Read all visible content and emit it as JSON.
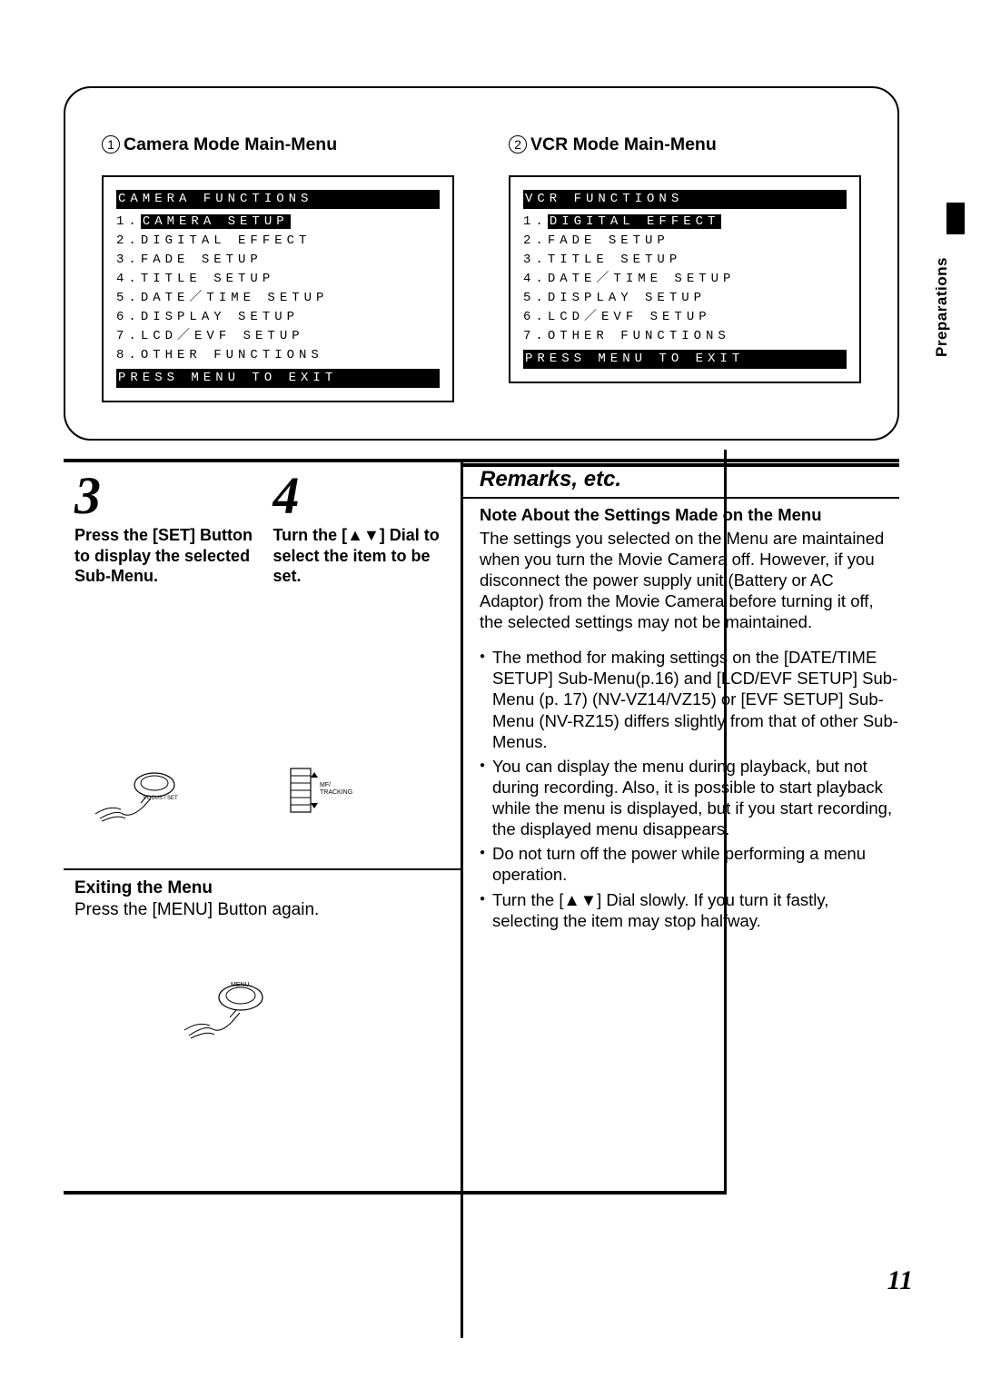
{
  "sidebar_label": "Preparations",
  "camera_menu": {
    "heading_num": "1",
    "heading": "Camera Mode Main-Menu",
    "title": "CAMERA FUNCTIONS",
    "items": [
      "CAMERA SETUP",
      "DIGITAL EFFECT",
      "FADE SETUP",
      "TITLE SETUP",
      "DATE／TIME SETUP",
      "DISPLAY SETUP",
      "LCD／EVF SETUP",
      "OTHER FUNCTIONS"
    ],
    "footer": "PRESS MENU TO EXIT"
  },
  "vcr_menu": {
    "heading_num": "2",
    "heading": "VCR Mode Main-Menu",
    "title": "VCR FUNCTIONS",
    "items": [
      "DIGITAL EFFECT",
      "FADE SETUP",
      "TITLE SETUP",
      "DATE／TIME SETUP",
      "DISPLAY SETUP",
      "LCD／EVF SETUP",
      "OTHER FUNCTIONS"
    ],
    "footer": "PRESS MENU TO EXIT"
  },
  "step3": {
    "num": "3",
    "caption": "Press the [SET] Button to display the selected Sub-Menu."
  },
  "step4": {
    "num": "4",
    "caption": "Turn the [▲▼] Dial to select the item to be set."
  },
  "illus1_label": "FOCUS / SET",
  "illus2_labels": {
    "mf": "MF/",
    "trk": "TRACKING"
  },
  "exiting": {
    "heading": "Exiting the Menu",
    "text": "Press the [MENU] Button again.",
    "label": "MENU"
  },
  "remarks_title": "Remarks, etc.",
  "notes": {
    "heading": "Note About the Settings Made on the Menu",
    "para": "The settings you selected on the Menu are maintained when you turn the Movie Camera off. However, if you disconnect the power supply unit (Battery or AC Adaptor) from the Movie Camera before turning it off, the selected settings may not be maintained.",
    "bullets": [
      "The method for making settings on the [DATE/TIME SETUP] Sub-Menu(p.16) and [LCD/EVF SETUP] Sub-Menu (p. 17) (NV-VZ14/VZ15) or [EVF SETUP] Sub-Menu (NV-RZ15) differs slightly from that of other Sub-Menus.",
      "You can display the menu during playback, but not during recording. Also, it is possible to start playback while the menu is displayed, but if you start recording, the displayed menu disappears.",
      "Do not turn off the power while performing a menu operation.",
      "Turn the [▲▼] Dial slowly. If you turn it fastly, selecting the item may stop halfway."
    ]
  },
  "page_number": "11"
}
